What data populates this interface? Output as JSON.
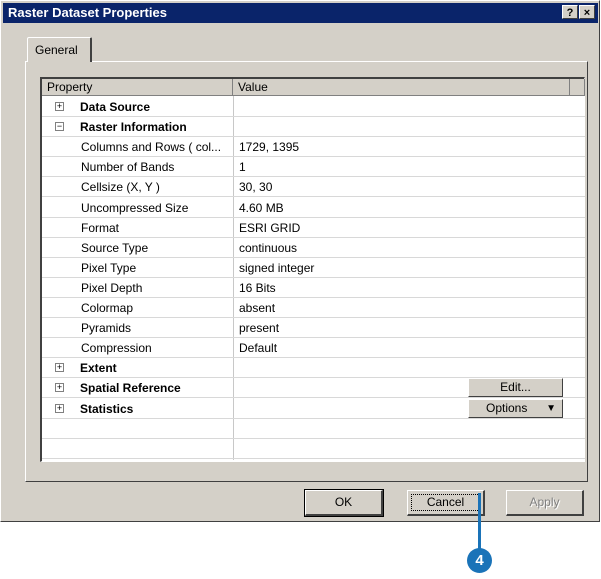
{
  "window": {
    "title": "Raster Dataset Properties",
    "help_label": "?",
    "close_label": "×"
  },
  "tabs": [
    {
      "label": "General"
    }
  ],
  "grid": {
    "headers": {
      "property": "Property",
      "value": "Value"
    },
    "rows": [
      {
        "kind": "group",
        "expander": "+",
        "label": "Data Source",
        "value": ""
      },
      {
        "kind": "group",
        "expander": "−",
        "label": "Raster Information",
        "value": ""
      },
      {
        "kind": "child",
        "label": "Columns and Rows ( col...",
        "value": "1729, 1395"
      },
      {
        "kind": "child",
        "label": "Number of Bands",
        "value": "1"
      },
      {
        "kind": "child",
        "label": "Cellsize (X, Y )",
        "value": "30, 30"
      },
      {
        "kind": "child",
        "label": "Uncompressed Size",
        "value": "4.60 MB"
      },
      {
        "kind": "child",
        "label": "Format",
        "value": "ESRI GRID"
      },
      {
        "kind": "child",
        "label": "Source Type",
        "value": "continuous"
      },
      {
        "kind": "child",
        "label": "Pixel Type",
        "value": "signed integer"
      },
      {
        "kind": "child",
        "label": "Pixel Depth",
        "value": "16 Bits"
      },
      {
        "kind": "child",
        "label": "Colormap",
        "value": "absent"
      },
      {
        "kind": "child",
        "label": "Pyramids",
        "value": "present"
      },
      {
        "kind": "child",
        "label": "Compression",
        "value": "Default"
      },
      {
        "kind": "group",
        "expander": "+",
        "label": "Extent",
        "value": ""
      },
      {
        "kind": "group",
        "expander": "+",
        "label": "Spatial Reference",
        "value": "",
        "button": "Edit..."
      },
      {
        "kind": "group",
        "expander": "+",
        "label": "Statistics",
        "value": "",
        "button": "Options",
        "button_arrow": "▼"
      },
      {
        "kind": "empty",
        "label": "",
        "value": ""
      },
      {
        "kind": "empty",
        "label": "",
        "value": ""
      }
    ]
  },
  "buttons": {
    "ok": "OK",
    "cancel": "Cancel",
    "apply": "Apply"
  },
  "callout": {
    "number": "4",
    "color": "#1a73b8"
  }
}
